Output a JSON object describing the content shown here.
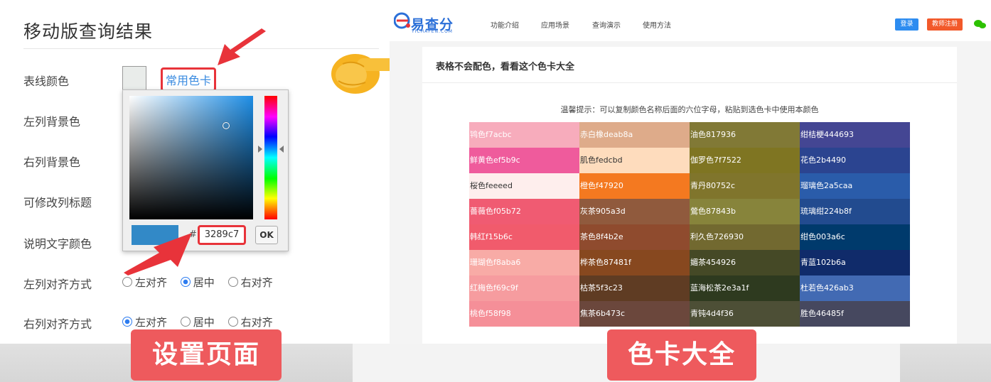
{
  "left": {
    "title": "移动版查询结果",
    "labels": [
      "表线颜色",
      "左列背景色",
      "右列背景色",
      "可修改列标题",
      "说明文字颜色",
      "左列对齐方式",
      "右列对齐方式"
    ],
    "common_colors_link": "常用色卡",
    "swatch_color": "#e9ecea",
    "picker": {
      "hash": "#",
      "hex_value": "3289c7",
      "ok_label": "OK",
      "preview_color": "#3289c7"
    },
    "align_left_col": {
      "options": [
        "左对齐",
        "居中",
        "右对齐"
      ],
      "selected": "居中"
    },
    "align_right_col": {
      "options": [
        "左对齐",
        "居中",
        "右对齐"
      ],
      "selected": "左对齐"
    }
  },
  "right": {
    "logo": {
      "text": "易查分",
      "sub": "YICHAFEN.COM"
    },
    "nav": [
      "功能介绍",
      "应用场景",
      "查询演示",
      "使用方法"
    ],
    "login_label": "登录",
    "register_label": "教师注册",
    "card_title": "表格不会配色，看看这个色卡大全",
    "tip": "温馨提示：可以复制颜色名称后面的六位字母，粘贴到选色卡中使用本颜色",
    "colors": [
      [
        {
          "label": "鸨色f7acbc",
          "bg": "#f7acbc",
          "fg": "#ffffff"
        },
        {
          "label": "赤白橡deab8a",
          "bg": "#deab8a",
          "fg": "#ffffff"
        },
        {
          "label": "油色817936",
          "bg": "#817936",
          "fg": "#ffffff"
        },
        {
          "label": "绀桔梗444693",
          "bg": "#444693",
          "fg": "#ffffff"
        }
      ],
      [
        {
          "label": "鲜黄色ef5b9c",
          "bg": "#ef5b9c",
          "fg": "#ffffff"
        },
        {
          "label": "肌色fedcbd",
          "bg": "#fedcbd",
          "fg": "#333333"
        },
        {
          "label": "伽罗色7f7522",
          "bg": "#7f7522",
          "fg": "#ffffff"
        },
        {
          "label": "花色2b4490",
          "bg": "#2b4490",
          "fg": "#ffffff"
        }
      ],
      [
        {
          "label": "桜色feeeed",
          "bg": "#feeeed",
          "fg": "#333333"
        },
        {
          "label": "橙色f47920",
          "bg": "#f47920",
          "fg": "#ffffff"
        },
        {
          "label": "青丹80752c",
          "bg": "#80752c",
          "fg": "#ffffff"
        },
        {
          "label": "瑠璃色2a5caa",
          "bg": "#2a5caa",
          "fg": "#ffffff"
        }
      ],
      [
        {
          "label": "薔薇色f05b72",
          "bg": "#f05b72",
          "fg": "#ffffff"
        },
        {
          "label": "灰茶905a3d",
          "bg": "#905a3d",
          "fg": "#ffffff"
        },
        {
          "label": "鶯色87843b",
          "bg": "#87843b",
          "fg": "#ffffff"
        },
        {
          "label": "琉璃绀224b8f",
          "bg": "#224b8f",
          "fg": "#ffffff"
        }
      ],
      [
        {
          "label": "韩红f15b6c",
          "bg": "#f15b6c",
          "fg": "#ffffff"
        },
        {
          "label": "茶色8f4b2e",
          "bg": "#8f4b2e",
          "fg": "#ffffff"
        },
        {
          "label": "利久色726930",
          "bg": "#726930",
          "fg": "#ffffff"
        },
        {
          "label": "绀色003a6c",
          "bg": "#003a6c",
          "fg": "#ffffff"
        }
      ],
      [
        {
          "label": "珊瑚色f8aba6",
          "bg": "#f8aba6",
          "fg": "#ffffff"
        },
        {
          "label": "桦茶色87481f",
          "bg": "#87481f",
          "fg": "#ffffff"
        },
        {
          "label": "媚茶454926",
          "bg": "#454926",
          "fg": "#ffffff"
        },
        {
          "label": "青蓝102b6a",
          "bg": "#102b6a",
          "fg": "#ffffff"
        }
      ],
      [
        {
          "label": "红梅色f69c9f",
          "bg": "#f69c9f",
          "fg": "#ffffff"
        },
        {
          "label": "枯茶5f3c23",
          "bg": "#5f3c23",
          "fg": "#ffffff"
        },
        {
          "label": "蓝海松茶2e3a1f",
          "bg": "#2e3a1f",
          "fg": "#ffffff"
        },
        {
          "label": "杜若色426ab3",
          "bg": "#426ab3",
          "fg": "#ffffff"
        }
      ],
      [
        {
          "label": "桃色f58f98",
          "bg": "#f58f98",
          "fg": "#ffffff"
        },
        {
          "label": "焦茶6b473c",
          "bg": "#6b473c",
          "fg": "#ffffff"
        },
        {
          "label": "青钝4d4f36",
          "bg": "#4d4f36",
          "fg": "#ffffff"
        },
        {
          "label": "胜色46485f",
          "bg": "#46485f",
          "fg": "#ffffff"
        }
      ]
    ]
  },
  "bottom": {
    "left_tag": "设置页面",
    "right_tag": "色卡大全",
    "tag_color": "#ee5a5d"
  },
  "accent": {
    "red_outline": "#e8333a",
    "link_blue": "#3a8be0"
  }
}
